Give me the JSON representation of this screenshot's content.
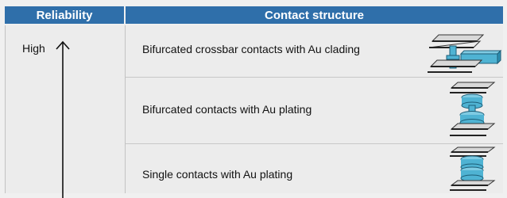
{
  "header": {
    "reliability": "Reliability",
    "contact_structure": "Contact structure"
  },
  "reliability": {
    "high_label": "High"
  },
  "rows": [
    {
      "label": "Bifurcated crossbar contacts with Au clading",
      "icon": "crossbar-contact-icon"
    },
    {
      "label": "Bifurcated contacts with Au plating",
      "icon": "bifurcated-contact-icon"
    },
    {
      "label": "Single contacts with Au plating",
      "icon": "single-contact-icon"
    }
  ],
  "colors": {
    "header_bg": "#2f6faa",
    "header_text": "#ffffff",
    "cell_bg": "#ececec",
    "contact_blue": "#4fb3d3"
  }
}
